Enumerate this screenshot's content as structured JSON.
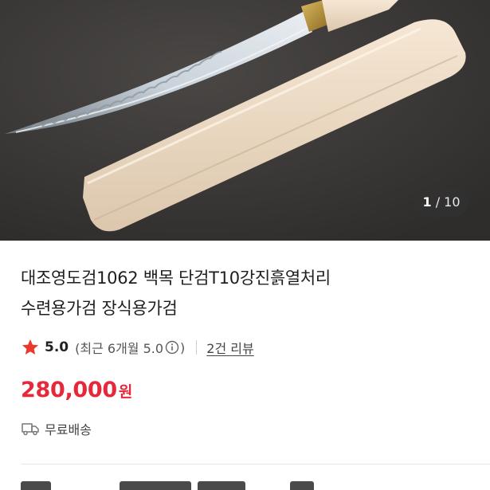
{
  "gallery": {
    "current": "1",
    "separator": "/",
    "total": "10",
    "image_alt": "대조영도검 백목 단검 product photo"
  },
  "product": {
    "title_line1": "대조영도검1062 백목 단검T10강진흙열처리",
    "title_line2": "수련용가검 장식용가검"
  },
  "rating": {
    "score": "5.0",
    "recent_open": "(최근 6개월 5.0",
    "recent_close": ")",
    "reviews_label": "2건 리뷰"
  },
  "price": {
    "amount": "280,000",
    "unit": "원"
  },
  "shipping": {
    "label": "무료배송"
  },
  "colors": {
    "price": "#e5283a",
    "star": "#e8392c"
  }
}
